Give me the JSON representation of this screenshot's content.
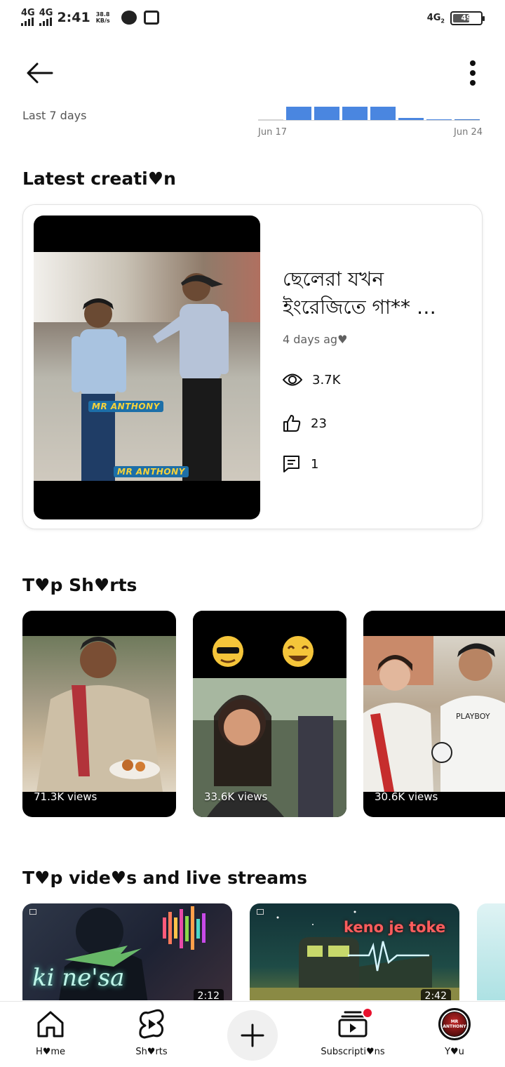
{
  "status_bar": {
    "signal1": "4G",
    "signal2": "4G",
    "time": "2:41",
    "speed_value": "38.8",
    "speed_unit": "KB/s",
    "network": "4G",
    "network_sub": "2",
    "battery": "49"
  },
  "header": {
    "period_label": "Last  7  days",
    "date_start": "Jun  17",
    "date_end": "Jun  24"
  },
  "mini_chart": {
    "type": "bar",
    "values": [
      0.08,
      1.0,
      1.0,
      1.0,
      1.0,
      0.2,
      0.12,
      0.12
    ],
    "colors": [
      "#cfcfcf",
      "#4a86e0",
      "#4a86e0",
      "#4a86e0",
      "#4a86e0",
      "#4a86e0",
      "#4a86e0",
      "#2f6fc9"
    ]
  },
  "latest": {
    "section_title": "Latest  creati♥n",
    "title": "ছেলেরা  যখন  ইংরেজিতে  গা**  …",
    "age": "4  days  ag♥",
    "views": "3.7K",
    "likes": "23",
    "comments": "1",
    "thumb_tag": "MR ANTHONY"
  },
  "shorts": {
    "section_title": "T♥p  Sh♥rts",
    "items": [
      {
        "views": "71.3K  views"
      },
      {
        "views": "33.6K  views"
      },
      {
        "views": "30.6K  views"
      }
    ]
  },
  "videos": {
    "section_title": "T♥p  vide♥s  and  live  streams",
    "items": [
      {
        "overlay_text": "ki ne'sa",
        "duration": "2:12"
      },
      {
        "overlay_text": "keno je toke",
        "duration": "2:42"
      }
    ]
  },
  "nav": {
    "home": "H♥me",
    "shorts": "Sh♥rts",
    "subscriptions": "Subscripti♥ns",
    "you": "Y♥u",
    "avatar_text": "MR ANTHONY"
  },
  "colors": {
    "accent_blue": "#4a86e0",
    "notification_red": "#e8112d"
  }
}
